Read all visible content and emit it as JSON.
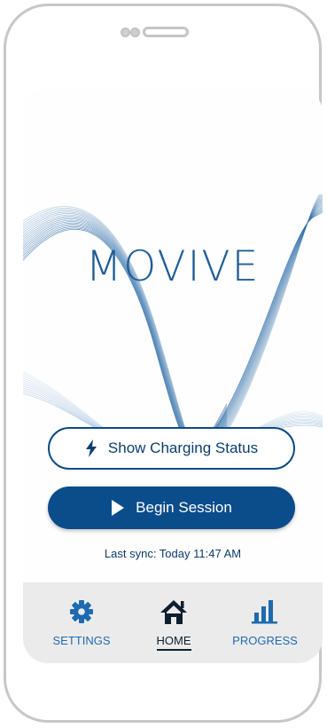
{
  "app": {
    "logo": "MOVIVE"
  },
  "actions": {
    "charging_label": "Show Charging Status",
    "begin_label": "Begin Session"
  },
  "status": {
    "last_sync": "Last sync: Today 11:47 AM"
  },
  "tabs": [
    {
      "label": "SETTINGS",
      "icon": "gear-icon",
      "active": false
    },
    {
      "label": "HOME",
      "icon": "home-icon",
      "active": true
    },
    {
      "label": "PROGRESS",
      "icon": "bar-chart-icon",
      "active": false
    }
  ],
  "colors": {
    "brand": "#1f5d96",
    "primary_button": "#0b4c8b",
    "tab_accent": "#1d6ab0",
    "tab_active": "#0d1e2e",
    "tab_bar_bg": "#ecebeb"
  }
}
